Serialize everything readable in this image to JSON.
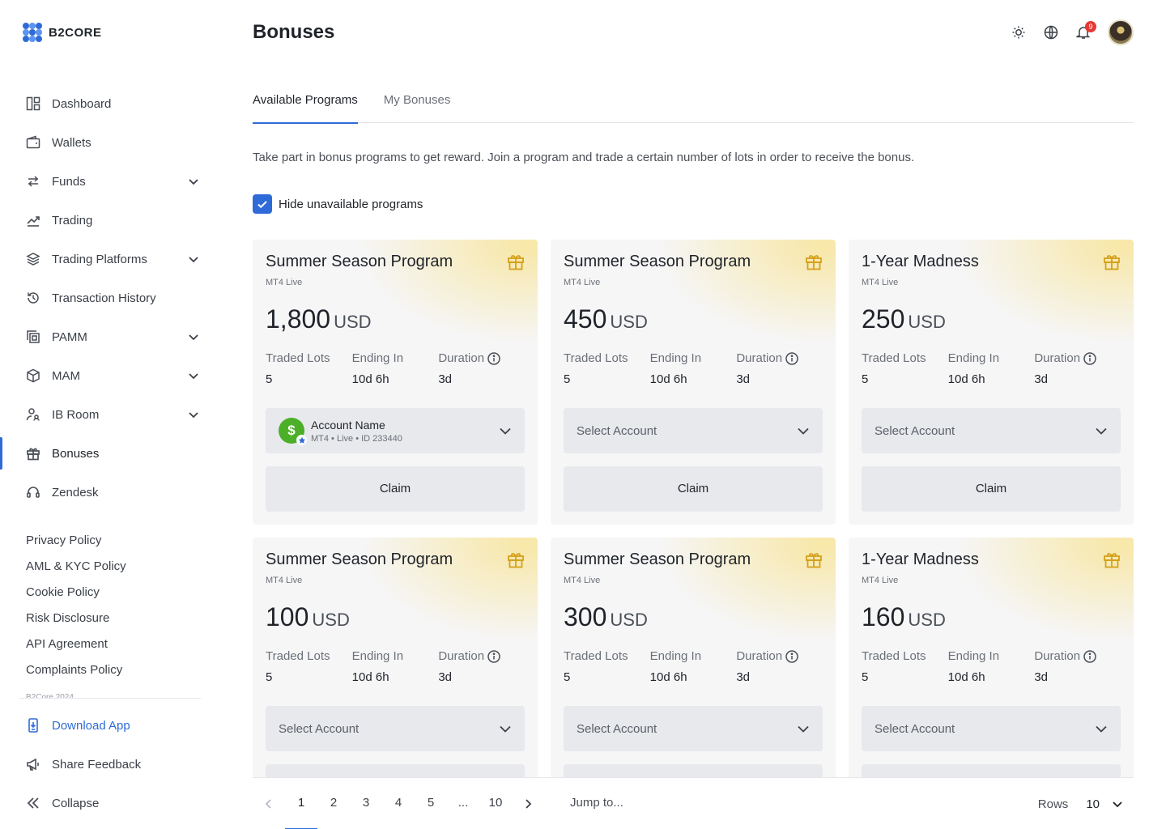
{
  "app": {
    "logo_text": "B2CORE"
  },
  "header": {
    "title": "Bonuses",
    "notification_count": "9"
  },
  "sidebar": {
    "items": [
      {
        "label": "Dashboard",
        "icon": "dashboard-icon",
        "expandable": false
      },
      {
        "label": "Wallets",
        "icon": "wallet-icon",
        "expandable": false
      },
      {
        "label": "Funds",
        "icon": "transfer-icon",
        "expandable": true
      },
      {
        "label": "Trading",
        "icon": "chart-line-icon",
        "expandable": false
      },
      {
        "label": "Trading Platforms",
        "icon": "layers-icon",
        "expandable": true
      },
      {
        "label": "Transaction History",
        "icon": "history-icon",
        "expandable": false
      },
      {
        "label": "PAMM",
        "icon": "copy-icon",
        "expandable": true
      },
      {
        "label": "MAM",
        "icon": "cube-icon",
        "expandable": true
      },
      {
        "label": "IB Room",
        "icon": "users-icon",
        "expandable": true
      },
      {
        "label": "Bonuses",
        "icon": "gift-icon",
        "expandable": false,
        "active": true
      },
      {
        "label": "Zendesk",
        "icon": "headset-icon",
        "expandable": false
      }
    ],
    "policies": [
      "Privacy Policy",
      "AML & KYC Policy",
      "Cookie Policy",
      "Risk Disclosure",
      "API Agreement",
      "Complaints Policy"
    ],
    "copyright": "B2Core 2024",
    "bottom": {
      "download": "Download App",
      "feedback": "Share Feedback",
      "collapse": "Collapse"
    }
  },
  "tabs": [
    {
      "label": "Available Programs",
      "active": true
    },
    {
      "label": "My Bonuses",
      "active": false
    }
  ],
  "description": "Take part in bonus programs to get reward. Join a program and trade a certain number of lots in order to receive the bonus.",
  "filter": {
    "label": "Hide unavailable programs",
    "checked": true
  },
  "labels": {
    "traded_lots": "Traded Lots",
    "ending_in": "Ending In",
    "duration": "Duration",
    "select_placeholder": "Select Account",
    "claim": "Claim"
  },
  "programs": [
    {
      "title": "Summer Season Program",
      "platform": "MT4 Live",
      "amount": "1,800",
      "currency": "USD",
      "traded_lots": "5",
      "ending_in": "10d 6h",
      "duration": "3d",
      "account": {
        "name": "Account Name",
        "meta": "MT4 • Live • ID 233440",
        "symbol": "$"
      }
    },
    {
      "title": "Summer Season Program",
      "platform": "MT4 Live",
      "amount": "450",
      "currency": "USD",
      "traded_lots": "5",
      "ending_in": "10d 6h",
      "duration": "3d"
    },
    {
      "title": "1-Year Madness",
      "platform": "MT4 Live",
      "amount": "250",
      "currency": "USD",
      "traded_lots": "5",
      "ending_in": "10d 6h",
      "duration": "3d"
    },
    {
      "title": "Summer Season Program",
      "platform": "MT4 Live",
      "amount": "100",
      "currency": "USD",
      "traded_lots": "5",
      "ending_in": "10d 6h",
      "duration": "3d"
    },
    {
      "title": "Summer Season Program",
      "platform": "MT4 Live",
      "amount": "300",
      "currency": "USD",
      "traded_lots": "5",
      "ending_in": "10d 6h",
      "duration": "3d"
    },
    {
      "title": "1-Year Madness",
      "platform": "MT4 Live",
      "amount": "160",
      "currency": "USD",
      "traded_lots": "5",
      "ending_in": "10d 6h",
      "duration": "3d"
    }
  ],
  "pagination": {
    "pages": [
      "1",
      "2",
      "3",
      "4",
      "5",
      "...",
      "10"
    ],
    "current": "1",
    "jump_placeholder": "Jump to...",
    "rows_label": "Rows",
    "rows_value": "10"
  },
  "colors": {
    "accent": "#2f6bd8",
    "gift": "#d4a017",
    "account_avatar": "#4caf28",
    "badge": "#e53935"
  }
}
